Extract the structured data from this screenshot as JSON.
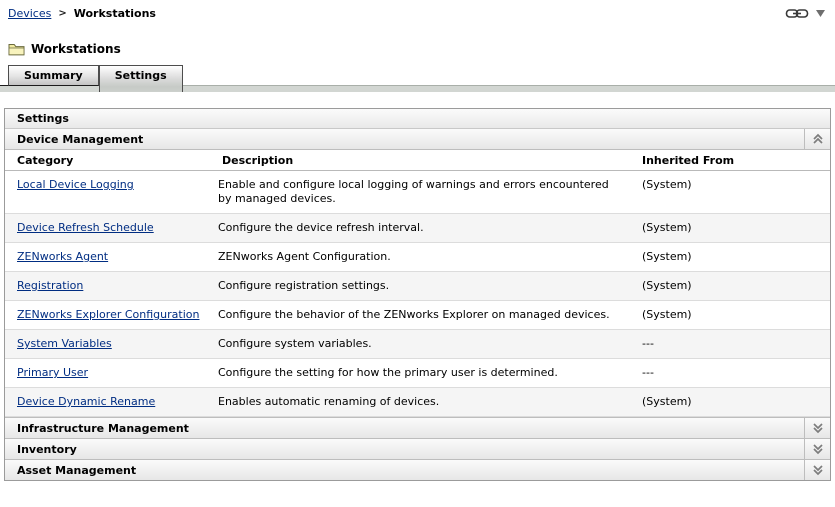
{
  "breadcrumb": {
    "devices": "Devices",
    "separator": ">",
    "current": "Workstations"
  },
  "toolbar": {
    "link_icon": "chain-link",
    "menu_icon": "dropdown-arrow"
  },
  "page": {
    "icon": "folder",
    "title": "Workstations"
  },
  "tabs": {
    "summary": "Summary",
    "settings": "Settings",
    "active": "Settings"
  },
  "panel": {
    "title": "Settings",
    "device_management": {
      "label": "Device Management",
      "expanded": true,
      "collapse_icon": "chevron-double-up"
    },
    "table": {
      "headers": {
        "category": "Category",
        "description": "Description",
        "inherited": "Inherited From"
      },
      "rows": [
        {
          "category": "Local Device Logging",
          "description": "Enable and configure local logging of warnings and errors encountered by managed devices.",
          "inherited": "(System)"
        },
        {
          "category": "Device Refresh Schedule",
          "description": "Configure the device refresh interval.",
          "inherited": "(System)"
        },
        {
          "category": "ZENworks Agent",
          "description": "ZENworks Agent Configuration.",
          "inherited": "(System)"
        },
        {
          "category": "Registration",
          "description": "Configure registration settings.",
          "inherited": "(System)"
        },
        {
          "category": "ZENworks Explorer Configuration",
          "description": "Configure the behavior of the ZENworks Explorer on managed devices.",
          "inherited": "(System)"
        },
        {
          "category": "System Variables",
          "description": "Configure system variables.",
          "inherited": "---"
        },
        {
          "category": "Primary User",
          "description": "Configure the setting for how the primary user is determined.",
          "inherited": "---"
        },
        {
          "category": "Device Dynamic Rename",
          "description": "Enables automatic renaming of devices.",
          "inherited": "(System)"
        }
      ]
    },
    "collapsed_sections": [
      {
        "label": "Infrastructure Management",
        "expand_icon": "chevron-double-down"
      },
      {
        "label": "Inventory",
        "expand_icon": "chevron-double-down"
      },
      {
        "label": "Asset Management",
        "expand_icon": "chevron-double-down"
      }
    ]
  },
  "colors": {
    "link": "#002d82",
    "panel_border": "#9b9b9b",
    "row_alt": "#f5f5f5",
    "tab_band": "#d2d6d2"
  }
}
